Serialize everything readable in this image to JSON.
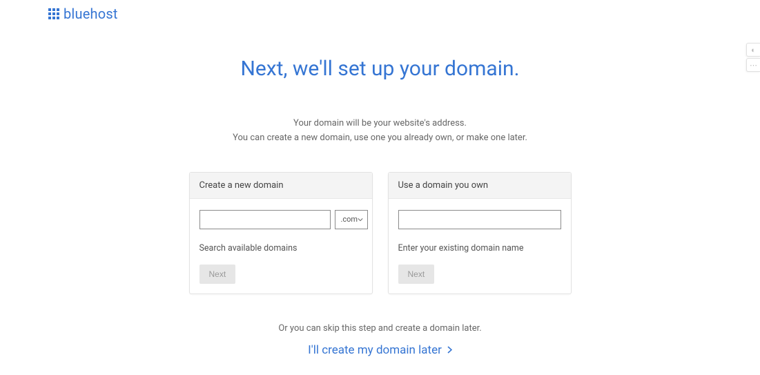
{
  "brand": {
    "name": "bluehost"
  },
  "page": {
    "title": "Next, we'll set up your domain.",
    "sub1": "Your domain will be your website's address.",
    "sub2": "You can create a new domain, use one you already own, or make one later."
  },
  "create_card": {
    "header": "Create a new domain",
    "tld_selected": ".com",
    "helper": "Search available domains",
    "next_label": "Next"
  },
  "own_card": {
    "header": "Use a domain you own",
    "helper": "Enter your existing domain name",
    "next_label": "Next"
  },
  "skip": {
    "text": "Or you can skip this step and create a domain later.",
    "link": "I'll create my domain later"
  }
}
